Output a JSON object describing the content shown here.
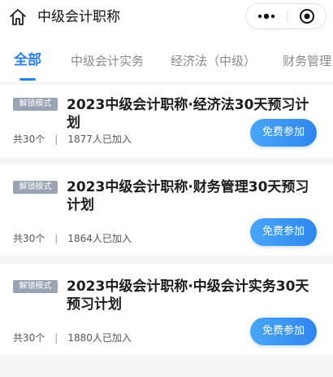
{
  "header": {
    "title": "中级会计职称",
    "home_icon": "home-icon",
    "more_icon": "more-dots-icon",
    "close_icon": "target-circle-icon"
  },
  "tabs": [
    {
      "label": "全部",
      "active": true
    },
    {
      "label": "中级会计实务",
      "active": false
    },
    {
      "label": "经济法（中级）",
      "active": false
    },
    {
      "label": "财务管理",
      "active": false
    }
  ],
  "colors": {
    "accent": "#2c7ff0",
    "badge": "#9aa3b4"
  },
  "cards": [
    {
      "badge": "解锁模式",
      "title": "2023中级会计职称·经济法30天预习计划",
      "count": "共30个",
      "joined": "1877人已加入",
      "button": "免费参加"
    },
    {
      "badge": "解锁模式",
      "title": "2023中级会计职称·财务管理30天预习计划",
      "count": "共30个",
      "joined": "1864人已加入",
      "button": "免费参加"
    },
    {
      "badge": "解锁模式",
      "title": "2023中级会计职称·中级会计实务30天预习计划",
      "count": "共30个",
      "joined": "1880人已加入",
      "button": "免费参加"
    }
  ]
}
